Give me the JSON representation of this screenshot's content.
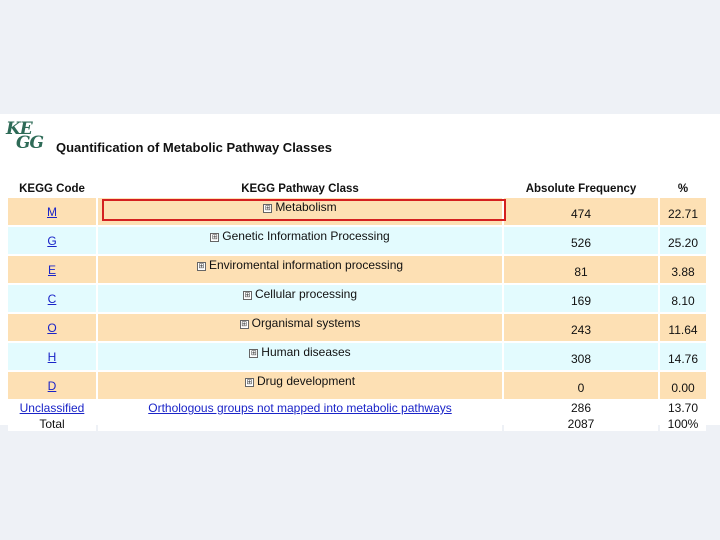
{
  "logo": {
    "line1": "KE",
    "line2": "GG"
  },
  "heading": "Quantification of Metabolic Pathway Classes",
  "columns": [
    "KEGG Code",
    "KEGG Pathway Class",
    "Absolute Frequency",
    "%"
  ],
  "rows": [
    {
      "code": "M",
      "class": "Metabolism",
      "freq": "474",
      "pct": "22.71"
    },
    {
      "code": "G",
      "class": "Genetic Information Processing",
      "freq": "526",
      "pct": "25.20"
    },
    {
      "code": "E",
      "class": "Enviromental information processing",
      "freq": "81",
      "pct": "3.88"
    },
    {
      "code": "C",
      "class": "Cellular processing",
      "freq": "169",
      "pct": "8.10"
    },
    {
      "code": "O",
      "class": "Organismal systems",
      "freq": "243",
      "pct": "11.64"
    },
    {
      "code": "H",
      "class": "Human diseases",
      "freq": "308",
      "pct": "14.76"
    },
    {
      "code": "D",
      "class": "Drug development",
      "freq": "0",
      "pct": "0.00"
    }
  ],
  "unclassified": {
    "code": "Unclassified",
    "class": "Orthologous groups not mapped into metabolic pathways",
    "freq": "286",
    "pct": "13.70"
  },
  "total": {
    "label": "Total",
    "freq": "2087",
    "pct": "100%"
  },
  "expand_glyph": "⊞",
  "colors": {
    "peach": "#fde0b4",
    "cyan": "#e3fbfe",
    "link": "#1a24c8",
    "highlight": "#d42020"
  }
}
